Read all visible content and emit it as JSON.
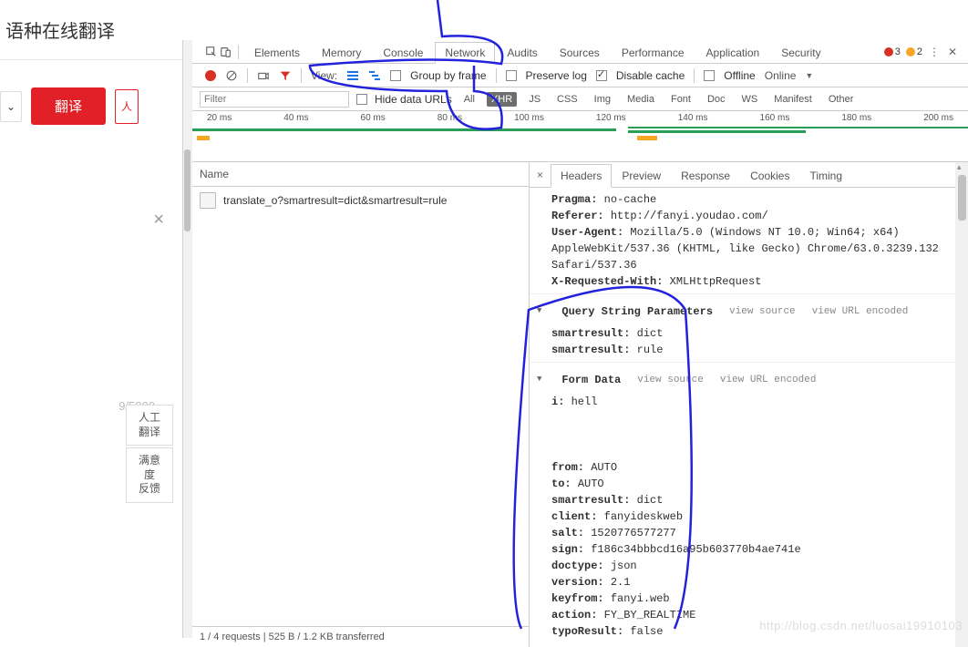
{
  "left": {
    "title": "语种在线翻译",
    "translate_btn": "翻译",
    "close": "×",
    "char_count": "9/5000",
    "side_btn1": "人工\n翻译",
    "side_btn2": "满意度\n反馈"
  },
  "devtools": {
    "tabs": [
      "Elements",
      "Memory",
      "Console",
      "Network",
      "Audits",
      "Sources",
      "Performance",
      "Application",
      "Security"
    ],
    "active_tab": "Network",
    "errors": "3",
    "warnings": "2",
    "toolbar": {
      "view_label": "View:",
      "group": "Group by frame",
      "preserve": "Preserve log",
      "disable": "Disable cache",
      "offline": "Offline",
      "online": "Online"
    },
    "filter": {
      "placeholder": "Filter",
      "hide": "Hide data URLs",
      "types": [
        "All",
        "XHR",
        "JS",
        "CSS",
        "Img",
        "Media",
        "Font",
        "Doc",
        "WS",
        "Manifest",
        "Other"
      ],
      "active_type": "XHR"
    },
    "timeline_ticks": [
      "20 ms",
      "40 ms",
      "60 ms",
      "80 ms",
      "100 ms",
      "120 ms",
      "140 ms",
      "160 ms",
      "180 ms",
      "200 ms"
    ],
    "name_header": "Name",
    "request_name": "translate_o?smartresult=dict&smartresult=rule",
    "status": "1 / 4 requests  |  525 B / 1.2 KB transferred",
    "detail_tabs": [
      "Headers",
      "Preview",
      "Response",
      "Cookies",
      "Timing"
    ],
    "active_detail": "Headers",
    "headers": {
      "pragma_k": "Pragma:",
      "pragma_v": "no-cache",
      "referer_k": "Referer:",
      "referer_v": "http://fanyi.youdao.com/",
      "ua_k": "User-Agent:",
      "ua_v": "Mozilla/5.0 (Windows NT 10.0; Win64; x64) AppleWebKit/537.36 (KHTML, like Gecko) Chrome/63.0.3239.132 Safari/537.36",
      "xreq_k": "X-Requested-With:",
      "xreq_v": "XMLHttpRequest",
      "qsp_title": "Query String Parameters",
      "viewsrc": "view source",
      "viewurl": "view URL encoded",
      "sr1_k": "smartresult:",
      "sr1_v": "dict",
      "sr2_k": "smartresult:",
      "sr2_v": "rule",
      "fd_title": "Form Data",
      "i_k": "i:",
      "i_v": "hell",
      "from_k": "from:",
      "from_v": "AUTO",
      "to_k": "to:",
      "to_v": "AUTO",
      "sr3_k": "smartresult:",
      "sr3_v": "dict",
      "client_k": "client:",
      "client_v": "fanyideskweb",
      "salt_k": "salt:",
      "salt_v": "1520776577277",
      "sign_k": "sign:",
      "sign_v": "f186c34bbbcd16a95b603770b4ae741e",
      "doctype_k": "doctype:",
      "doctype_v": "json",
      "version_k": "version:",
      "version_v": "2.1",
      "keyfrom_k": "keyfrom:",
      "keyfrom_v": "fanyi.web",
      "action_k": "action:",
      "action_v": "FY_BY_REALTIME",
      "typo_k": "typoResult:",
      "typo_v": "false"
    }
  },
  "watermark": "http://blog.csdn.net/luosai19910103"
}
